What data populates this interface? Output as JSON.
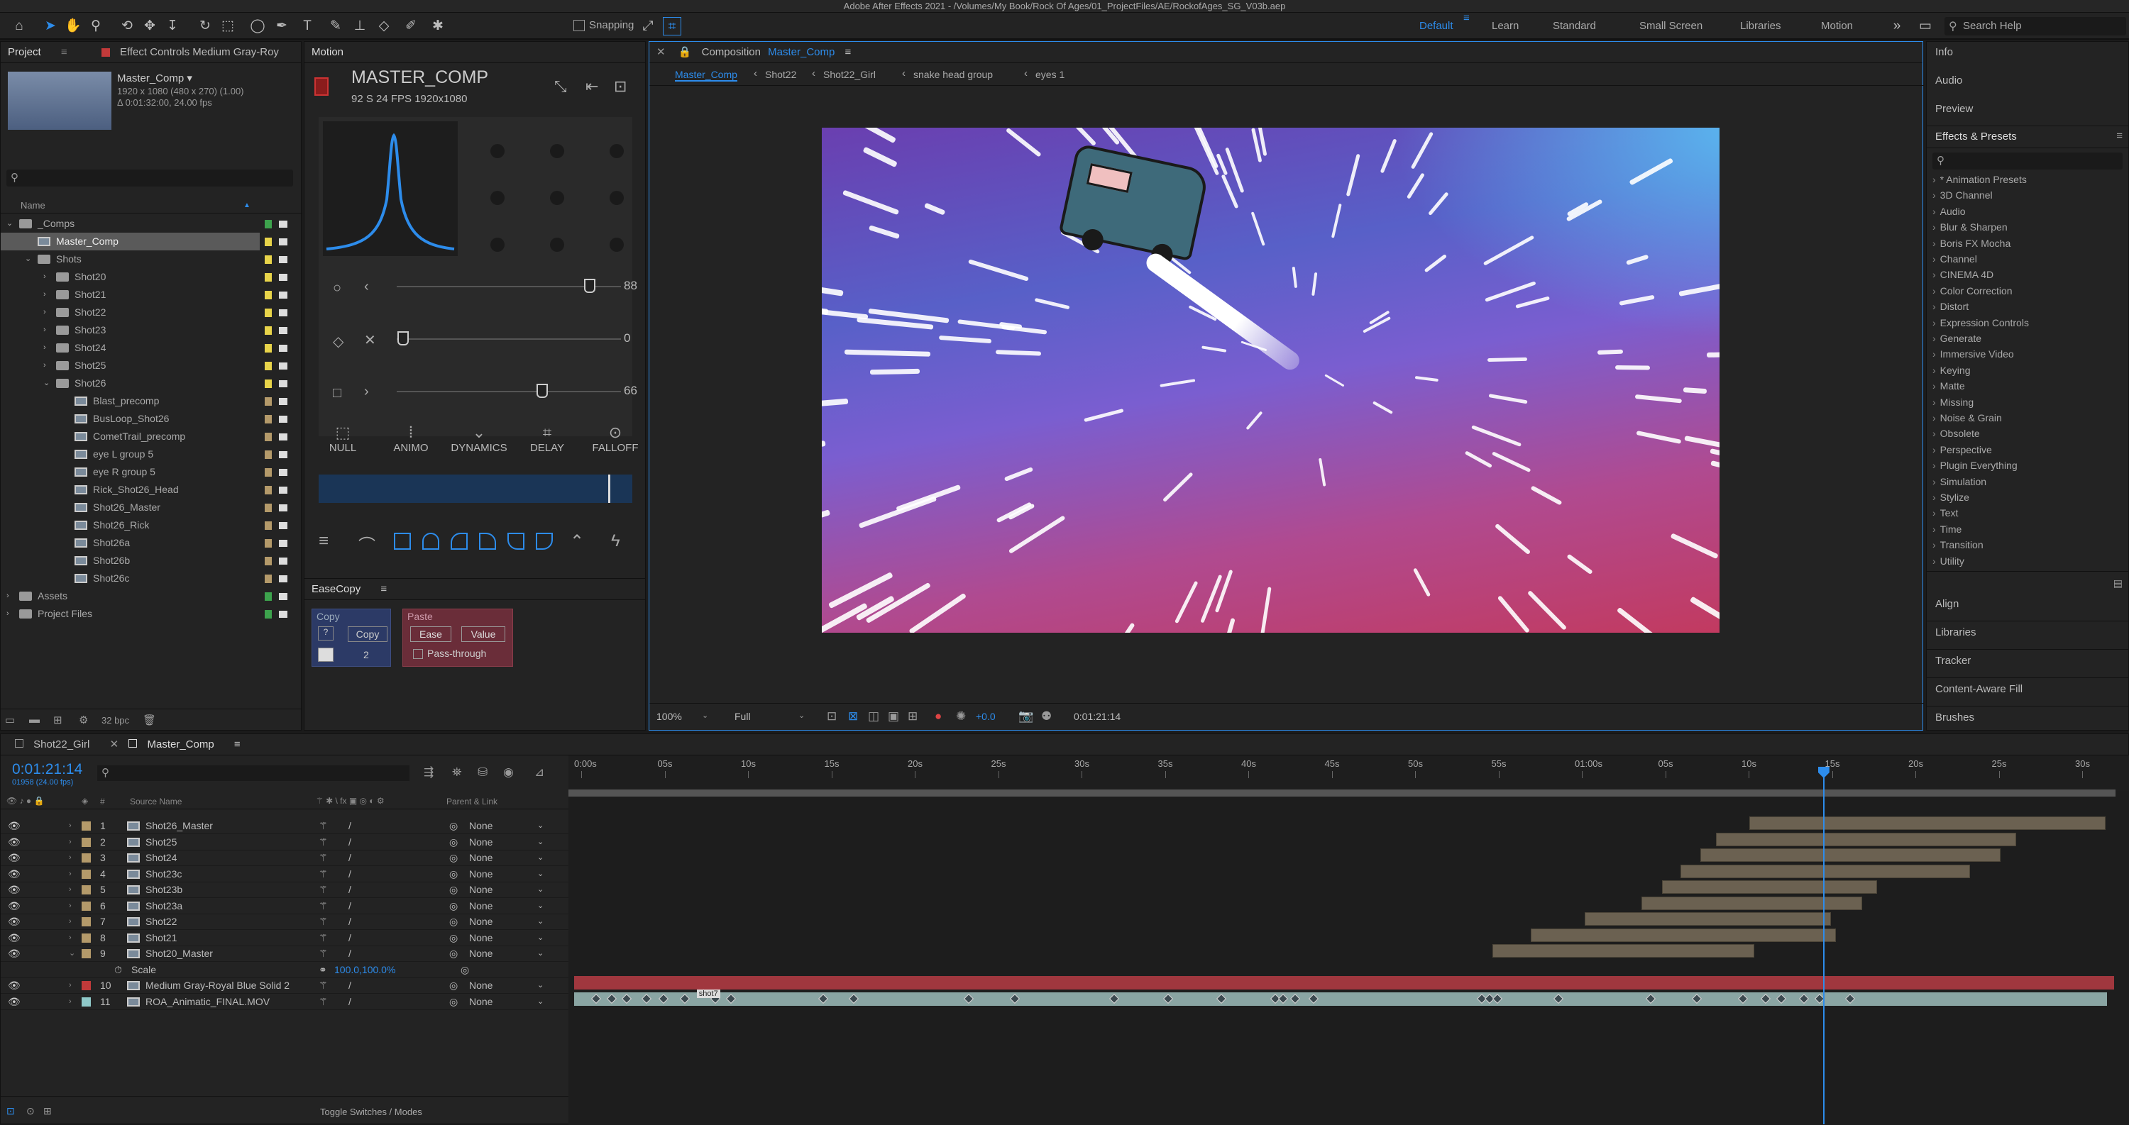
{
  "window_title": "Adobe After Effects 2021 - /Volumes/My Book/Rock Of Ages/01_ProjectFiles/AE/RockofAges_SG_V03b.aep",
  "toolbar": {
    "snapping_label": "Snapping"
  },
  "workspaces": [
    "Default",
    "Learn",
    "Standard",
    "Small Screen",
    "Libraries",
    "Motion"
  ],
  "search_help": "Search Help",
  "project_panel": {
    "tab_project": "Project",
    "tab_effect_controls": "Effect Controls Medium Gray-Roy",
    "comp_name": "Master_Comp ▾",
    "comp_info_1": "1920 x 1080  (480 x 270) (1.00)",
    "comp_info_2": "Δ 0:01:32:00, 24.00 fps",
    "col_name": "Name",
    "items": [
      {
        "label": "_Comps",
        "indent": 0,
        "type": "folder",
        "twirl": "open",
        "color": "#3da34d"
      },
      {
        "label": "Master_Comp",
        "indent": 1,
        "type": "comp",
        "twirl": "",
        "color": "#e8d44a",
        "selected": true
      },
      {
        "label": "Shots",
        "indent": 1,
        "type": "folder",
        "twirl": "open",
        "color": "#e8d44a"
      },
      {
        "label": "Shot20",
        "indent": 2,
        "type": "folder",
        "twirl": "closed",
        "color": "#e8d44a"
      },
      {
        "label": "Shot21",
        "indent": 2,
        "type": "folder",
        "twirl": "closed",
        "color": "#e8d44a"
      },
      {
        "label": "Shot22",
        "indent": 2,
        "type": "folder",
        "twirl": "closed",
        "color": "#e8d44a"
      },
      {
        "label": "Shot23",
        "indent": 2,
        "type": "folder",
        "twirl": "closed",
        "color": "#e8d44a"
      },
      {
        "label": "Shot24",
        "indent": 2,
        "type": "folder",
        "twirl": "closed",
        "color": "#e8d44a"
      },
      {
        "label": "Shot25",
        "indent": 2,
        "type": "folder",
        "twirl": "closed",
        "color": "#e8d44a"
      },
      {
        "label": "Shot26",
        "indent": 2,
        "type": "folder",
        "twirl": "open",
        "color": "#e8d44a"
      },
      {
        "label": "Blast_precomp",
        "indent": 3,
        "type": "comp",
        "twirl": "",
        "color": "#b49a6a"
      },
      {
        "label": "BusLoop_Shot26",
        "indent": 3,
        "type": "comp",
        "twirl": "",
        "color": "#b49a6a"
      },
      {
        "label": "CometTrail_precomp",
        "indent": 3,
        "type": "comp",
        "twirl": "",
        "color": "#b49a6a"
      },
      {
        "label": "eye L group 5",
        "indent": 3,
        "type": "comp",
        "twirl": "",
        "color": "#b49a6a"
      },
      {
        "label": "eye R group 5",
        "indent": 3,
        "type": "comp",
        "twirl": "",
        "color": "#b49a6a"
      },
      {
        "label": "Rick_Shot26_Head",
        "indent": 3,
        "type": "comp",
        "twirl": "",
        "color": "#b49a6a"
      },
      {
        "label": "Shot26_Master",
        "indent": 3,
        "type": "comp",
        "twirl": "",
        "color": "#b49a6a"
      },
      {
        "label": "Shot26_Rick",
        "indent": 3,
        "type": "comp",
        "twirl": "",
        "color": "#b49a6a"
      },
      {
        "label": "Shot26a",
        "indent": 3,
        "type": "comp",
        "twirl": "",
        "color": "#b49a6a"
      },
      {
        "label": "Shot26b",
        "indent": 3,
        "type": "comp",
        "twirl": "",
        "color": "#b49a6a"
      },
      {
        "label": "Shot26c",
        "indent": 3,
        "type": "comp",
        "twirl": "",
        "color": "#b49a6a"
      },
      {
        "label": "Assets",
        "indent": 0,
        "type": "folder",
        "twirl": "closed",
        "color": "#3da34d"
      },
      {
        "label": "Project Files",
        "indent": 0,
        "type": "folder",
        "twirl": "closed",
        "color": "#3da34d"
      }
    ],
    "bpc": "32 bpc"
  },
  "motion_panel": {
    "tab": "Motion",
    "comp_name": "MASTER_COMP",
    "comp_meta": "92 S    24 FPS    1920x1080",
    "sliders": [
      {
        "value": "88",
        "pos": 0.86
      },
      {
        "value": "0",
        "pos": 0.03
      },
      {
        "value": "66",
        "pos": 0.65
      }
    ],
    "buttons": [
      "NULL",
      "ANIMO",
      "DYNAMICS",
      "DELAY",
      "FALLOFF"
    ]
  },
  "easecopy": {
    "title": "EaseCopy",
    "copy_title": "Copy",
    "copy_btn": "Copy",
    "copy_q": "?",
    "copy_count": "2",
    "paste_title": "Paste",
    "ease_btn": "Ease",
    "value_btn": "Value",
    "pass_through": "Pass-through"
  },
  "composition": {
    "tab_prefix": "Composition",
    "tab_name": "Master_Comp",
    "breadcrumbs": [
      "Master_Comp",
      "Shot22",
      "Shot22_Girl",
      "snake head group",
      "eyes 1"
    ],
    "zoom": "100%",
    "resolution": "Full",
    "exposure": "+0.0",
    "timecode": "0:01:21:14"
  },
  "right_panels": {
    "top": [
      "Info",
      "Audio",
      "Preview"
    ],
    "effects_title": "Effects & Presets",
    "effects": [
      "* Animation Presets",
      "3D Channel",
      "Audio",
      "Blur & Sharpen",
      "Boris FX Mocha",
      "Channel",
      "CINEMA 4D",
      "Color Correction",
      "Distort",
      "Expression Controls",
      "Generate",
      "Immersive Video",
      "Keying",
      "Matte",
      "Missing",
      "Noise & Grain",
      "Obsolete",
      "Perspective",
      "Plugin Everything",
      "Simulation",
      "Stylize",
      "Text",
      "Time",
      "Transition",
      "Utility"
    ],
    "bottom": [
      "Align",
      "Libraries",
      "Tracker",
      "Content-Aware Fill",
      "Brushes"
    ]
  },
  "timeline": {
    "tabs": [
      "Shot22_Girl",
      "Master_Comp"
    ],
    "timecode": "0:01:21:14",
    "frames": "01958 (24.00 fps)",
    "col_source": "Source Name",
    "col_parent": "Parent & Link",
    "ruler": [
      "0:00s",
      "05s",
      "10s",
      "15s",
      "20s",
      "25s",
      "30s",
      "35s",
      "40s",
      "45s",
      "50s",
      "55s",
      "01:00s",
      "05s",
      "10s",
      "15s",
      "20s",
      "25s",
      "30s"
    ],
    "playhead": 0.811,
    "layers": [
      {
        "num": "1",
        "name": "Shot26_Master",
        "parent": "None",
        "color": "#b49a6a",
        "start": 0.767,
        "end": 0.998
      },
      {
        "num": "2",
        "name": "Shot25",
        "parent": "None",
        "color": "#b49a6a",
        "start": 0.745,
        "end": 0.94
      },
      {
        "num": "3",
        "name": "Shot24",
        "parent": "None",
        "color": "#b49a6a",
        "start": 0.735,
        "end": 0.93
      },
      {
        "num": "4",
        "name": "Shot23c",
        "parent": "None",
        "color": "#b49a6a",
        "start": 0.722,
        "end": 0.91
      },
      {
        "num": "5",
        "name": "Shot23b",
        "parent": "None",
        "color": "#b49a6a",
        "start": 0.71,
        "end": 0.85
      },
      {
        "num": "6",
        "name": "Shot23a",
        "parent": "None",
        "color": "#b49a6a",
        "start": 0.697,
        "end": 0.84
      },
      {
        "num": "7",
        "name": "Shot22",
        "parent": "None",
        "color": "#b49a6a",
        "start": 0.66,
        "end": 0.82
      },
      {
        "num": "8",
        "name": "Shot21",
        "parent": "None",
        "color": "#b49a6a",
        "start": 0.625,
        "end": 0.823
      },
      {
        "num": "9",
        "name": "Shot20_Master",
        "parent": "None",
        "color": "#b49a6a",
        "start": 0.6,
        "end": 0.77
      }
    ],
    "scale_label": "Scale",
    "scale_value": "100.0,100.0%",
    "layer10": {
      "num": "10",
      "name": "Medium Gray-Royal Blue Solid 2",
      "parent": "None",
      "color": "#c23a3a"
    },
    "layer11": {
      "num": "11",
      "name": "ROA_Animatic_FINAL.MOV",
      "parent": "None",
      "color": "#8fc9c9",
      "marker": "shot7"
    },
    "toggle_label": "Toggle Switches / Modes"
  }
}
